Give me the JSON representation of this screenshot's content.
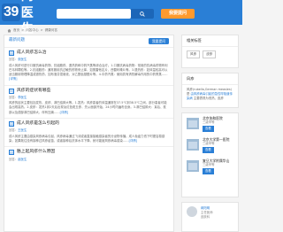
{
  "header": {
    "logo_num": "39",
    "logo_text": "问医生",
    "search_placeholder": "",
    "ask_label": "我要提问"
  },
  "breadcrumb": [
    "首页",
    "问答中心",
    "健康问答"
  ],
  "main": {
    "title": "最新问题",
    "ask_button": "我要提问",
    "questions": [
      {
        "title": "成人风疹怎么治",
        "meta_prefix": "回答：",
        "doctor": "张医生",
        "body": "成人风疹可进行口服抗病毒药物、抗组胺药、退热药和中药汽蒸等综合治疗。1.口服抗病毒药物：常用的抗病毒药物有利巴韦林颗粒等。2.抗组胺药：通常服用抗过敏的药物来止痒，如氯雷他定片、西替利嗪片等。3.退热药：如体温较高可以适当服用物理降温或退热药，如布洛芬混悬液、对乙酰氨基酚片等。4.中药汽蒸：使用具有清热解毒作用的中药熏蒸……",
        "more": "[详情]"
      },
      {
        "title": "风疹的症状有哪些",
        "meta_prefix": "回答：",
        "doctor": "李医生",
        "body": "风疹的症状主要包括发热、皮疹、淋巴结肿大等。1.发热：风疹患者的体温通常在37.5℃到38.5℃之间，部分患者可能会出现高热。2.皮疹：发热1到2天后出现淡红色斑丘疹，先从面部开始，24小时内遍布全身。3.淋巴结肿大：耳后、枕部以及颈部淋巴结肿大，伴有压痛……",
        "more": "[详情]"
      },
      {
        "title": "成人风疹是怎么引起的",
        "meta_prefix": "回答：",
        "doctor": "王医生",
        "body": "成人风疹主要由感染风疹病毒引起，风疹病毒通过飞沫或者直接接触感染者的分泌物传播。成人免疫力低下时更容易感染，如果既往没有接种过风疹疫苗，或者接种后抗体水平下降，就可能被风疹病毒感染……",
        "more": "[详情]"
      },
      {
        "title": "胳上起风疹什么原因",
        "meta_prefix": "回答：",
        "doctor": "赵医生",
        "body": "",
        "more": ""
      }
    ]
  },
  "sidebar": {
    "related_title": "相关标签",
    "tags": [
      "风疹",
      "皮疹"
    ],
    "ask_title": "风疹",
    "ask_text_1": "风疹(rubella,German measles)是",
    "ask_link": "由风疹病毒引起的急性呼吸道传染病",
    "ask_text_2": "主要表现为低热、皮疹",
    "hospitals": [
      {
        "name": "北京协和医院",
        "sub": "三级甲等",
        "btn": "查看"
      },
      {
        "name": "北京大学第一医院",
        "sub": "三级甲等",
        "btn": "查看"
      },
      {
        "name": "复旦大学附属华山",
        "sub": "三级甲等",
        "btn": "查看"
      }
    ],
    "doctor_title": "推荐医生",
    "doctor": {
      "name": "蒋阳明",
      "title": "主任医师",
      "dept": "皮肤科"
    }
  }
}
